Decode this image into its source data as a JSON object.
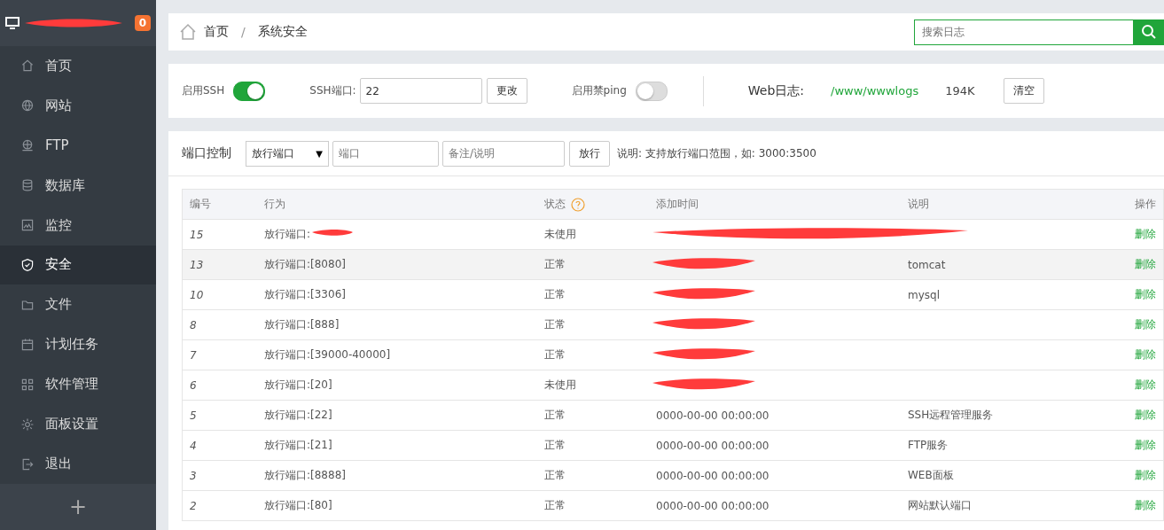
{
  "sidebar": {
    "header": {
      "redacted": true,
      "badge": "0"
    },
    "items": [
      {
        "label": "首页",
        "selected": false
      },
      {
        "label": "网站",
        "selected": false
      },
      {
        "label": "FTP",
        "selected": false
      },
      {
        "label": "数据库",
        "selected": false
      },
      {
        "label": "监控",
        "selected": false
      },
      {
        "label": "安全",
        "selected": true
      },
      {
        "label": "文件",
        "selected": false
      },
      {
        "label": "计划任务",
        "selected": false
      },
      {
        "label": "软件管理",
        "selected": false
      },
      {
        "label": "面板设置",
        "selected": false
      },
      {
        "label": "退出",
        "selected": false
      }
    ],
    "add_button": "+"
  },
  "breadcrumb": [
    "首页",
    "系统安全"
  ],
  "breadcrumb_separator": "/",
  "search": {
    "placeholder": "搜索日志"
  },
  "settings": {
    "ssh_label": "启用SSH",
    "ssh_on": true,
    "port_label": "SSH端口:",
    "port_value": "22",
    "change_button": "更改",
    "ping_label": "启用禁ping",
    "ping_on": false,
    "log_label": "Web日志:",
    "log_path": "/www/wwwlogs",
    "log_size": "194K",
    "clear_button": "清空"
  },
  "port_control": {
    "title": "端口控制",
    "select_value": "放行端口",
    "select_caret": "▼",
    "port_placeholder": "端口",
    "note_placeholder": "备注/说明",
    "submit_button": "放行",
    "hint": "说明: 支持放行端口范围，如: 3000:3500"
  },
  "table": {
    "columns": [
      "编号",
      "行为",
      "状态",
      "添加时间",
      "说明",
      "操作"
    ],
    "rows": [
      {
        "id": "15",
        "action": "放行端口:",
        "status": "未使用",
        "op": "删除",
        "redacted": true,
        "action_redacted": true,
        "selected": false
      },
      {
        "id": "13",
        "action": "放行端口:[8080]",
        "status": "正常",
        "note": "tomcat",
        "op": "删除",
        "redacted": true,
        "selected": true
      },
      {
        "id": "10",
        "action": "放行端口:[3306]",
        "status": "正常",
        "note": "mysql",
        "op": "删除",
        "redacted": true,
        "selected": false
      },
      {
        "id": "8",
        "action": "放行端口:[888]",
        "status": "正常",
        "op": "删除",
        "redacted": true,
        "selected": false
      },
      {
        "id": "7",
        "action": "放行端口:[39000-40000]",
        "status": "正常",
        "op": "删除",
        "redacted": true,
        "selected": false
      },
      {
        "id": "6",
        "action": "放行端口:[20]",
        "status": "未使用",
        "op": "删除",
        "redacted": true,
        "selected": false
      },
      {
        "id": "5",
        "action": "放行端口:[22]",
        "status": "正常",
        "time": "0000-00-00 00:00:00",
        "note": "SSH远程管理服务",
        "op": "删除",
        "selected": false
      },
      {
        "id": "4",
        "action": "放行端口:[21]",
        "status": "正常",
        "time": "0000-00-00 00:00:00",
        "note": "FTP服务",
        "op": "删除",
        "selected": false
      },
      {
        "id": "3",
        "action": "放行端口:[8888]",
        "status": "正常",
        "time": "0000-00-00 00:00:00",
        "note": "WEB面板",
        "op": "删除",
        "selected": false
      },
      {
        "id": "2",
        "action": "放行端口:[80]",
        "status": "正常",
        "time": "0000-00-00 00:00:00",
        "note": "网站默认端口",
        "op": "删除",
        "selected": false
      }
    ]
  }
}
